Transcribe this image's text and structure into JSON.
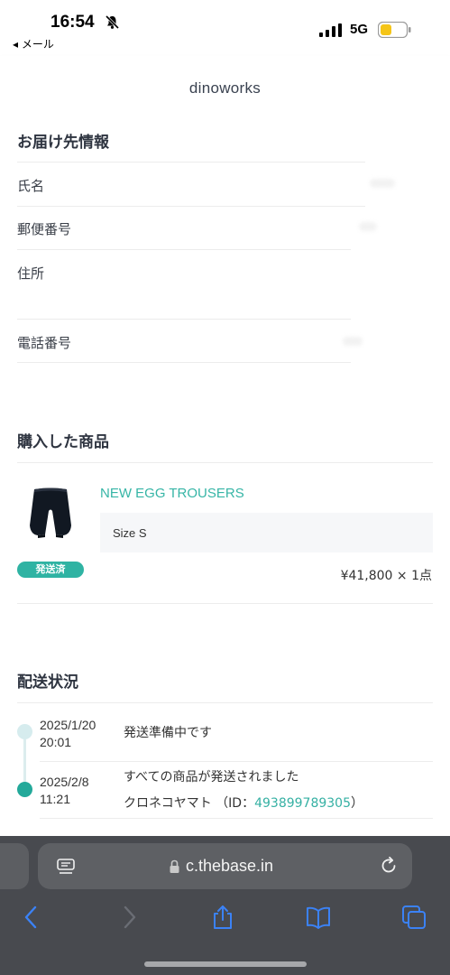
{
  "status_bar": {
    "time": "16:54",
    "back_label": "◂ メール",
    "network": "5G",
    "battery_level": 0.2
  },
  "header": {
    "title": "dinoworks"
  },
  "shipping_info": {
    "title": "お届け先情報",
    "fields": [
      {
        "label": "氏名"
      },
      {
        "label": "郵便番号"
      },
      {
        "label": "住所"
      },
      {
        "label": "電話番号"
      }
    ]
  },
  "purchased": {
    "title": "購入した商品",
    "product_name": "NEW EGG TROUSERS",
    "size": "Size S",
    "status_badge": "発送済",
    "price": "¥41,800 × 1点"
  },
  "delivery": {
    "title": "配送状況",
    "events": [
      {
        "date": "2025/1/20",
        "time": "20:01",
        "text": "発送準備中です"
      },
      {
        "date": "2025/2/8",
        "time": "11:21",
        "text": "すべての商品が発送されました",
        "carrier": "クロネコヤマト （ID：",
        "tracking_id": "493899789305",
        "carrier_close": "）"
      }
    ]
  },
  "browser": {
    "url": "c.thebase.in"
  },
  "colors": {
    "accent": "#36b5a6",
    "toolbar": "#484a4f",
    "icon_blue": "#3b82f6"
  }
}
